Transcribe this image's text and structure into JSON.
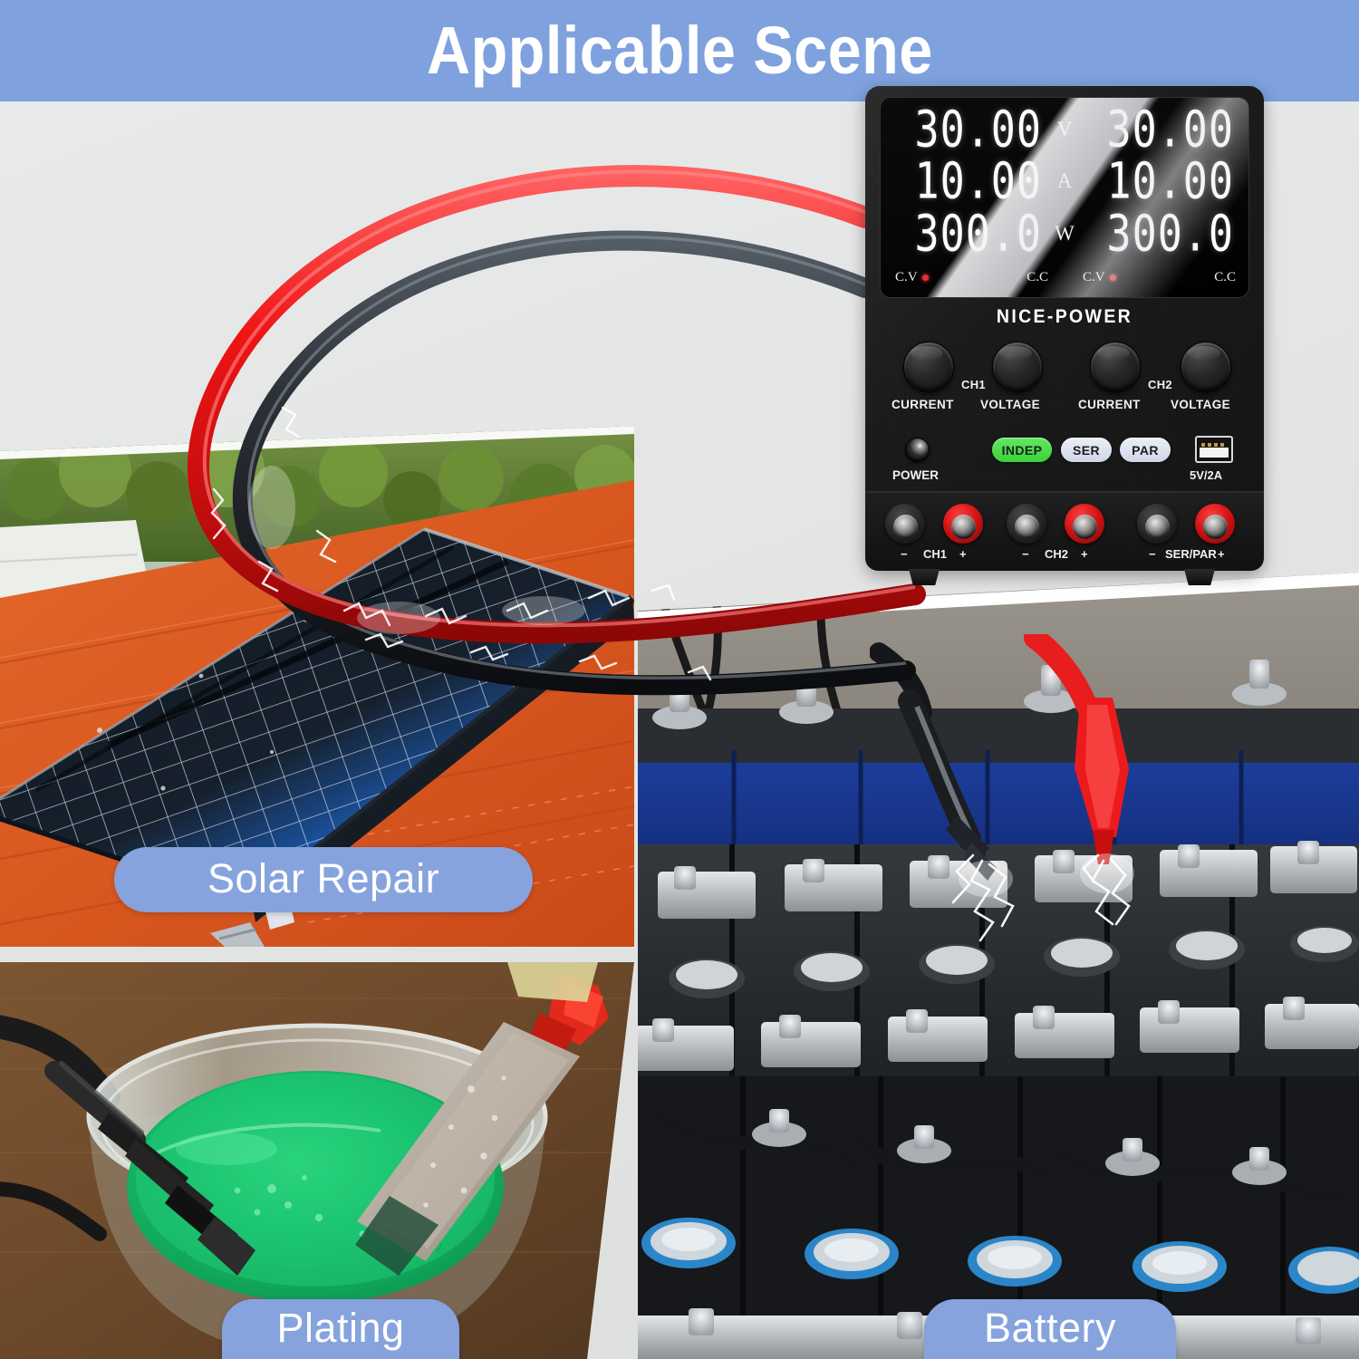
{
  "header": {
    "title": "Applicable Scene",
    "band_color": "#7fa1de"
  },
  "background_color": "#e4e6e6",
  "accent_color": "#86a3dd",
  "device": {
    "brand": "NICE-POWER",
    "display": {
      "rows": [
        {
          "unit": "V",
          "ch1_value": "30.00",
          "ch2_value": "30.00"
        },
        {
          "unit": "A",
          "ch1_value": "10.00",
          "ch2_value": "10.00"
        },
        {
          "unit": "W",
          "ch1_value": "300.0",
          "ch2_value": "300.0"
        }
      ],
      "status": [
        {
          "label": "C.V",
          "led": "on"
        },
        {
          "label": "C.C",
          "led": "off"
        },
        {
          "label": "C.V",
          "led": "on"
        },
        {
          "label": "C.C",
          "led": "off"
        }
      ]
    },
    "knobs": [
      {
        "label": "CURRENT",
        "channel": "CH1"
      },
      {
        "label": "VOLTAGE",
        "channel": "CH1"
      },
      {
        "label": "CURRENT",
        "channel": "CH2"
      },
      {
        "label": "VOLTAGE",
        "channel": "CH2"
      }
    ],
    "channel_tags": [
      "CH1",
      "CH2"
    ],
    "power_label": "POWER",
    "mode_buttons": [
      {
        "label": "INDEP",
        "active": true,
        "color": "#44d844"
      },
      {
        "label": "SER",
        "active": false,
        "color": "#dde2ee"
      },
      {
        "label": "PAR",
        "active": false,
        "color": "#dde2ee"
      }
    ],
    "usb": {
      "label": "5V/2A",
      "icon": "usb-icon"
    },
    "terminals": [
      {
        "group": "CH1",
        "minus": "−",
        "plus": "+"
      },
      {
        "group": "CH2",
        "minus": "−",
        "plus": "+"
      },
      {
        "group": "SER/PAR",
        "minus": "−",
        "plus": "+"
      }
    ]
  },
  "scenes": [
    {
      "id": "solar",
      "caption": "Solar Repair"
    },
    {
      "id": "plating",
      "caption": "Plating"
    },
    {
      "id": "battery",
      "caption": "Battery"
    }
  ],
  "cables": {
    "positive_color": "#e81d1d",
    "negative_color": "#2b3038"
  }
}
